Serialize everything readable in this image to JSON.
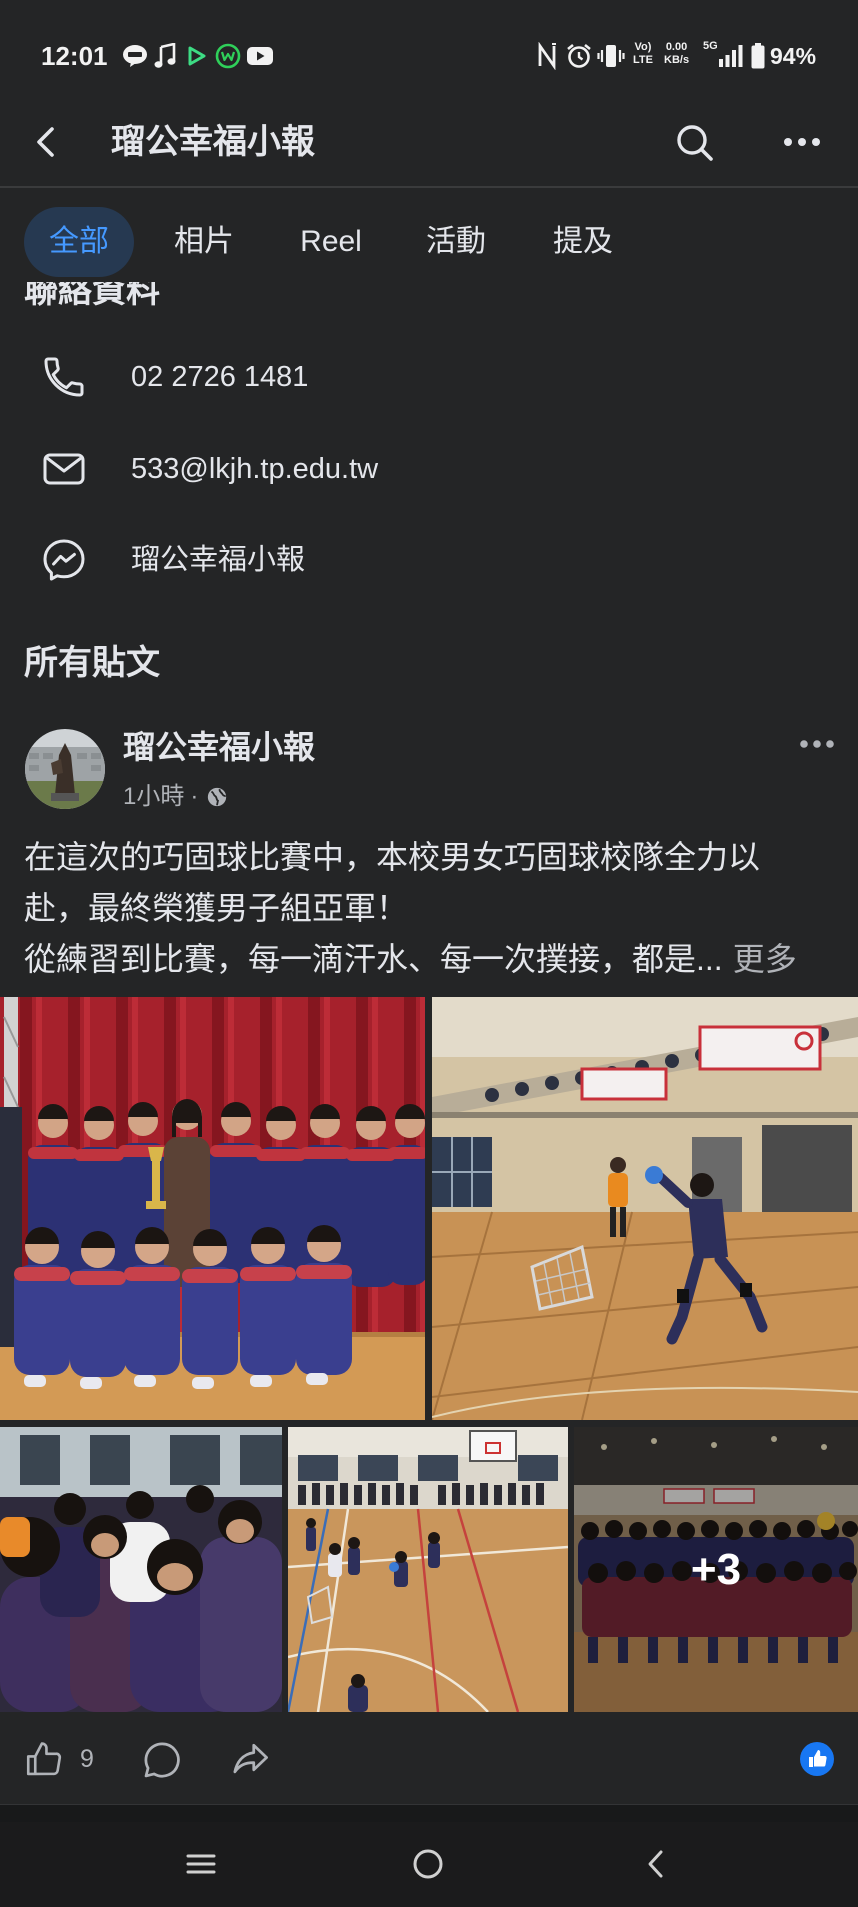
{
  "status_bar": {
    "time": "12:01",
    "volte_top": "Vo)",
    "volte_bottom": "LTE",
    "net_speed": "0.00",
    "net_unit": "KB/s",
    "network_type": "5G",
    "battery": "94%"
  },
  "header": {
    "title": "瑠公幸福小報"
  },
  "tabs": [
    {
      "label": "全部",
      "active": true
    },
    {
      "label": "相片",
      "active": false
    },
    {
      "label": "Reel",
      "active": false
    },
    {
      "label": "活動",
      "active": false
    },
    {
      "label": "提及",
      "active": false
    }
  ],
  "contact": {
    "heading": "聯絡資料",
    "phone": "02 2726 1481",
    "email": "533@lkjh.tp.edu.tw",
    "messenger": "瑠公幸福小報"
  },
  "posts_section": {
    "heading": "所有貼文"
  },
  "post": {
    "author": "瑠公幸福小報",
    "time": "1小時",
    "time_separator": "·",
    "text_lines": [
      "在這次的巧固球比賽中，本校男女巧固球校隊全力以",
      "赴，最終榮獲男子組亞軍！",
      "從練習到比賽，每一滴汗水、每一次撲接，都是..."
    ],
    "see_more": "更多",
    "more_photos": "+3",
    "like_count": "9"
  },
  "colors": {
    "background": "#242526",
    "text_primary": "#e4e6eb",
    "text_secondary": "#b0b3b8",
    "active_tab_background": "#263951",
    "active_tab_text": "#4599ff",
    "like_blue": "#1877f2"
  },
  "icons": {
    "header": [
      "back-arrow-icon",
      "search-icon",
      "more-horizontal-icon"
    ],
    "contact": [
      "phone-icon",
      "mail-icon",
      "messenger-icon"
    ],
    "post": [
      "globe-icon",
      "more-horizontal-icon",
      "like-icon",
      "comment-icon",
      "share-icon",
      "like-reaction-icon"
    ],
    "navigation": [
      "recent-apps-icon",
      "home-icon",
      "back-icon"
    ]
  }
}
